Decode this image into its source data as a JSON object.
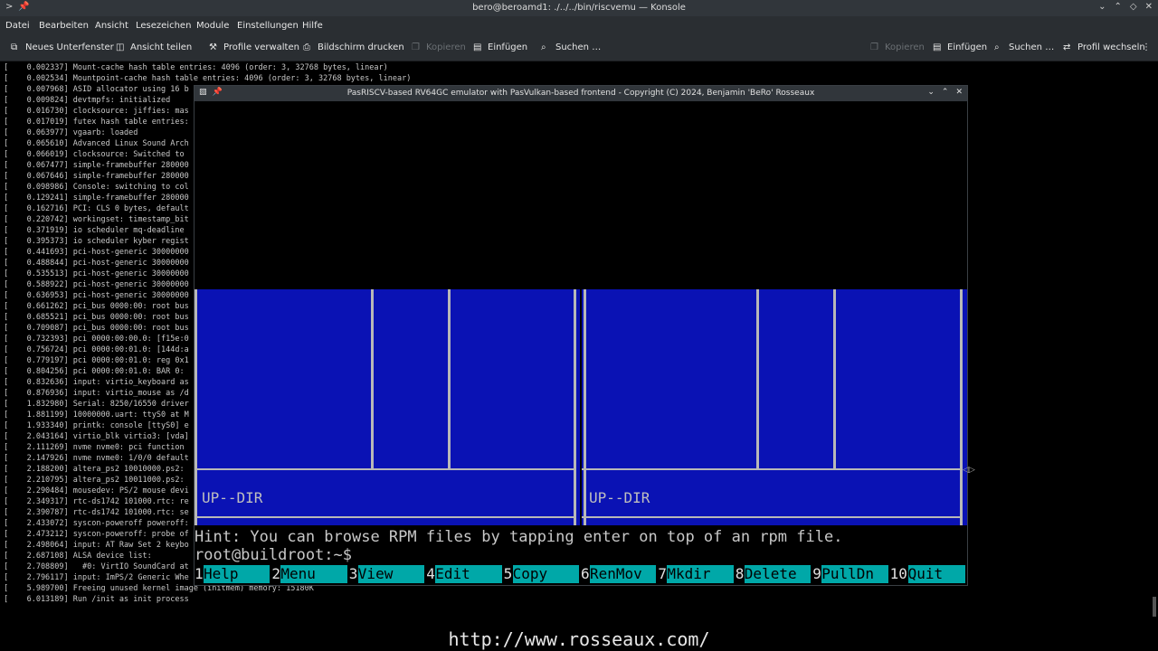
{
  "window": {
    "title": "bero@beroamd1: ./../../bin/riscvemu — Konsole",
    "left_icons": [
      "chevron-icon",
      "pin-icon"
    ],
    "right_icons": [
      "minimize-icon",
      "restore-icon",
      "close-icon"
    ]
  },
  "menu": [
    "Datei",
    "Bearbeiten",
    "Ansicht",
    "Lesezeichen",
    "Module",
    "Einstellungen",
    "Hilfe"
  ],
  "toolbar": {
    "new_tab": "Neues Unterfenster",
    "split_view": "Ansicht teilen",
    "manage_profiles": "Profile verwalten",
    "print_screen": "Bildschirm drucken",
    "copy": "Kopieren",
    "paste": "Einfügen",
    "search": "Suchen …",
    "copy2": "Kopieren",
    "paste2": "Einfügen",
    "search2": "Suchen …",
    "switch_profile": "Profil wechseln"
  },
  "terminal_lines": [
    "[    0.002337] Mount-cache hash table entries: 4096 (order: 3, 32768 bytes, linear)",
    "[    0.002534] Mountpoint-cache hash table entries: 4096 (order: 3, 32768 bytes, linear)",
    "[    0.007968] ASID allocator using 16 b",
    "[    0.009824] devtmpfs: initialized",
    "[    0.016730] clocksource: jiffies: mas",
    "[    0.017019] futex hash table entries:",
    "[    0.063977] vgaarb: loaded",
    "[    0.065610] Advanced Linux Sound Arch",
    "[    0.066019] clocksource: Switched to",
    "[    0.067477] simple-framebuffer 280000",
    "[    0.067646] simple-framebuffer 280000",
    "[    0.098986] Console: switching to col",
    "[    0.129241] simple-framebuffer 280000",
    "[    0.162716] PCI: CLS 0 bytes, default",
    "[    0.220742] workingset: timestamp_bit",
    "[    0.371919] io scheduler mq-deadline",
    "[    0.395373] io scheduler kyber regist",
    "[    0.441693] pci-host-generic 30000000",
    "[    0.488844] pci-host-generic 30000000",
    "[    0.535513] pci-host-generic 30000000",
    "[    0.588922] pci-host-generic 30000000",
    "[    0.636953] pci-host-generic 30000000",
    "[    0.661262] pci_bus 0000:00: root bus",
    "[    0.685521] pci_bus 0000:00: root bus",
    "[    0.709087] pci_bus 0000:00: root bus",
    "[    0.732393] pci 0000:00:00.0: [f15e:0",
    "[    0.756724] pci 0000:00:01.0: [144d:a",
    "[    0.779197] pci 0000:00:01.0: reg 0x1",
    "[    0.804256] pci 0000:00:01.0: BAR 0:",
    "[    0.832636] input: virtio_keyboard as",
    "[    0.876936] input: virtio_mouse as /d",
    "[    1.832980] Serial: 8250/16550 driver",
    "[    1.881199] 10000000.uart: ttyS0 at M",
    "[    1.933340] printk: console [ttyS0] e",
    "[    2.043164] virtio_blk virtio3: [vda]",
    "[    2.111269] nvme nvme0: pci function",
    "[    2.147926] nvme nvme0: 1/0/0 default",
    "[    2.188200] altera_ps2 10010000.ps2:",
    "[    2.210795] altera_ps2 10011000.ps2:",
    "[    2.290484] mousedev: PS/2 mouse devi",
    "[    2.349317] rtc-ds1742 101000.rtc: re",
    "[    2.390787] rtc-ds1742 101000.rtc: se",
    "[    2.433072] syscon-poweroff poweroff:",
    "[    2.473212] syscon-poweroff: probe of",
    "[    2.498064] input: AT Raw Set 2 keybo",
    "[    2.687108] ALSA device list:",
    "[    2.708809]   #0: VirtIO SoundCard at",
    "[    2.796117] input: ImPS/2 Generic Whe",
    "[    5.989700] Freeing unused kernel image (initmem) memory: 15180K",
    "[    6.013189] Run /init as init process"
  ],
  "emulator": {
    "title": "PasRISCV-based RV64GC emulator with PasVulkan-based frontend - Copyright (C) 2024, Benjamin 'BeRo' Rosseaux",
    "left_panel_label": "UP--DIR",
    "right_panel_label": "UP--DIR",
    "hint": "Hint: You can browse RPM files by tapping enter on top of an rpm file.",
    "prompt": "root@buildroot:~$",
    "fkeys": [
      {
        "num": "1",
        "label": "Help"
      },
      {
        "num": "2",
        "label": "Menu"
      },
      {
        "num": "3",
        "label": "View"
      },
      {
        "num": "4",
        "label": "Edit"
      },
      {
        "num": "5",
        "label": "Copy"
      },
      {
        "num": "6",
        "label": "RenMov"
      },
      {
        "num": "7",
        "label": "Mkdir"
      },
      {
        "num": "8",
        "label": "Delete"
      },
      {
        "num": "9",
        "label": "PullDn"
      },
      {
        "num": "10",
        "label": "Quit"
      }
    ],
    "colors": {
      "panel": "#0a12b4",
      "fkey": "#00a8a8"
    }
  },
  "footer_url": "http://www.rosseaux.com/"
}
